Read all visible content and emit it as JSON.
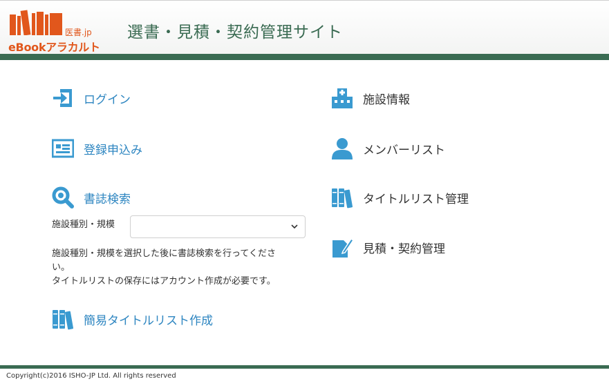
{
  "header": {
    "logo_sub": "医書.jp",
    "logo_text": "eBookアラカルト",
    "site_title": "選書・見積・契約管理サイト"
  },
  "left_menu": {
    "login": "ログイン",
    "register": "登録申込み",
    "search": "書誌検索",
    "quick_list": "簡易タイトルリスト作成"
  },
  "search_form": {
    "facility_label": "施設種別・規模",
    "facility_value": "",
    "note_lines": [
      "施設種別・規模を選択した後に書誌検索を行ってくださ",
      "い。",
      "タイトルリストの保存にはアカウント作成が必要です。"
    ]
  },
  "right_menu": {
    "facility": "施設情報",
    "members": "メンバーリスト",
    "title_list": "タイトルリスト管理",
    "estimate": "見積・契約管理"
  },
  "footer": {
    "copyright": "Copyright(c)2016 ISHO-JP Ltd. All rights reserved"
  },
  "colors": {
    "brand_green": "#3a6b52",
    "logo_orange": "#e1571c",
    "link_blue": "#2e86c1",
    "icon_blue": "#3a9ad0"
  },
  "icons": [
    "login-icon",
    "register-form-icon",
    "search-icon",
    "books-icon",
    "hospital-icon",
    "person-icon",
    "edit-document-icon",
    "chevron-down-icon"
  ]
}
